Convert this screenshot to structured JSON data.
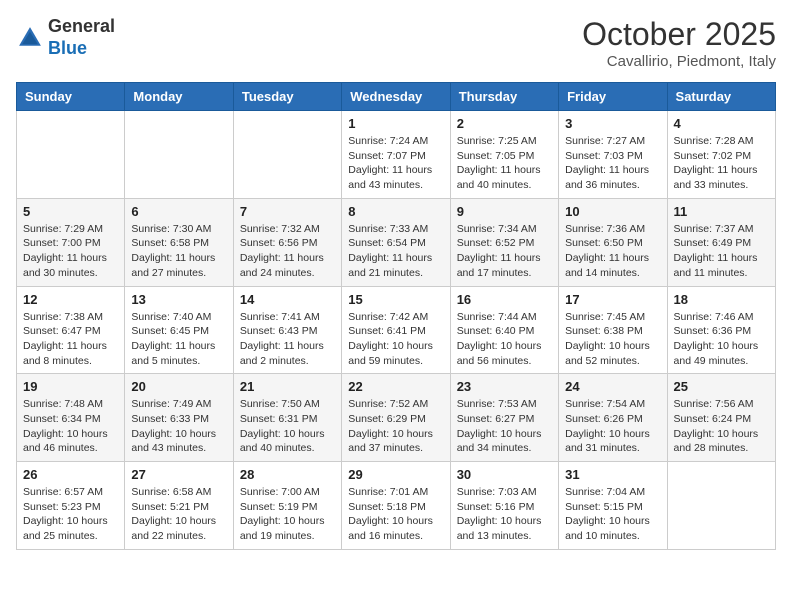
{
  "logo": {
    "general": "General",
    "blue": "Blue"
  },
  "header": {
    "month": "October 2025",
    "location": "Cavallirio, Piedmont, Italy"
  },
  "days_of_week": [
    "Sunday",
    "Monday",
    "Tuesday",
    "Wednesday",
    "Thursday",
    "Friday",
    "Saturday"
  ],
  "weeks": [
    [
      {
        "day": "",
        "info": ""
      },
      {
        "day": "",
        "info": ""
      },
      {
        "day": "",
        "info": ""
      },
      {
        "day": "1",
        "info": "Sunrise: 7:24 AM\nSunset: 7:07 PM\nDaylight: 11 hours and 43 minutes."
      },
      {
        "day": "2",
        "info": "Sunrise: 7:25 AM\nSunset: 7:05 PM\nDaylight: 11 hours and 40 minutes."
      },
      {
        "day": "3",
        "info": "Sunrise: 7:27 AM\nSunset: 7:03 PM\nDaylight: 11 hours and 36 minutes."
      },
      {
        "day": "4",
        "info": "Sunrise: 7:28 AM\nSunset: 7:02 PM\nDaylight: 11 hours and 33 minutes."
      }
    ],
    [
      {
        "day": "5",
        "info": "Sunrise: 7:29 AM\nSunset: 7:00 PM\nDaylight: 11 hours and 30 minutes."
      },
      {
        "day": "6",
        "info": "Sunrise: 7:30 AM\nSunset: 6:58 PM\nDaylight: 11 hours and 27 minutes."
      },
      {
        "day": "7",
        "info": "Sunrise: 7:32 AM\nSunset: 6:56 PM\nDaylight: 11 hours and 24 minutes."
      },
      {
        "day": "8",
        "info": "Sunrise: 7:33 AM\nSunset: 6:54 PM\nDaylight: 11 hours and 21 minutes."
      },
      {
        "day": "9",
        "info": "Sunrise: 7:34 AM\nSunset: 6:52 PM\nDaylight: 11 hours and 17 minutes."
      },
      {
        "day": "10",
        "info": "Sunrise: 7:36 AM\nSunset: 6:50 PM\nDaylight: 11 hours and 14 minutes."
      },
      {
        "day": "11",
        "info": "Sunrise: 7:37 AM\nSunset: 6:49 PM\nDaylight: 11 hours and 11 minutes."
      }
    ],
    [
      {
        "day": "12",
        "info": "Sunrise: 7:38 AM\nSunset: 6:47 PM\nDaylight: 11 hours and 8 minutes."
      },
      {
        "day": "13",
        "info": "Sunrise: 7:40 AM\nSunset: 6:45 PM\nDaylight: 11 hours and 5 minutes."
      },
      {
        "day": "14",
        "info": "Sunrise: 7:41 AM\nSunset: 6:43 PM\nDaylight: 11 hours and 2 minutes."
      },
      {
        "day": "15",
        "info": "Sunrise: 7:42 AM\nSunset: 6:41 PM\nDaylight: 10 hours and 59 minutes."
      },
      {
        "day": "16",
        "info": "Sunrise: 7:44 AM\nSunset: 6:40 PM\nDaylight: 10 hours and 56 minutes."
      },
      {
        "day": "17",
        "info": "Sunrise: 7:45 AM\nSunset: 6:38 PM\nDaylight: 10 hours and 52 minutes."
      },
      {
        "day": "18",
        "info": "Sunrise: 7:46 AM\nSunset: 6:36 PM\nDaylight: 10 hours and 49 minutes."
      }
    ],
    [
      {
        "day": "19",
        "info": "Sunrise: 7:48 AM\nSunset: 6:34 PM\nDaylight: 10 hours and 46 minutes."
      },
      {
        "day": "20",
        "info": "Sunrise: 7:49 AM\nSunset: 6:33 PM\nDaylight: 10 hours and 43 minutes."
      },
      {
        "day": "21",
        "info": "Sunrise: 7:50 AM\nSunset: 6:31 PM\nDaylight: 10 hours and 40 minutes."
      },
      {
        "day": "22",
        "info": "Sunrise: 7:52 AM\nSunset: 6:29 PM\nDaylight: 10 hours and 37 minutes."
      },
      {
        "day": "23",
        "info": "Sunrise: 7:53 AM\nSunset: 6:27 PM\nDaylight: 10 hours and 34 minutes."
      },
      {
        "day": "24",
        "info": "Sunrise: 7:54 AM\nSunset: 6:26 PM\nDaylight: 10 hours and 31 minutes."
      },
      {
        "day": "25",
        "info": "Sunrise: 7:56 AM\nSunset: 6:24 PM\nDaylight: 10 hours and 28 minutes."
      }
    ],
    [
      {
        "day": "26",
        "info": "Sunrise: 6:57 AM\nSunset: 5:23 PM\nDaylight: 10 hours and 25 minutes."
      },
      {
        "day": "27",
        "info": "Sunrise: 6:58 AM\nSunset: 5:21 PM\nDaylight: 10 hours and 22 minutes."
      },
      {
        "day": "28",
        "info": "Sunrise: 7:00 AM\nSunset: 5:19 PM\nDaylight: 10 hours and 19 minutes."
      },
      {
        "day": "29",
        "info": "Sunrise: 7:01 AM\nSunset: 5:18 PM\nDaylight: 10 hours and 16 minutes."
      },
      {
        "day": "30",
        "info": "Sunrise: 7:03 AM\nSunset: 5:16 PM\nDaylight: 10 hours and 13 minutes."
      },
      {
        "day": "31",
        "info": "Sunrise: 7:04 AM\nSunset: 5:15 PM\nDaylight: 10 hours and 10 minutes."
      },
      {
        "day": "",
        "info": ""
      }
    ]
  ]
}
